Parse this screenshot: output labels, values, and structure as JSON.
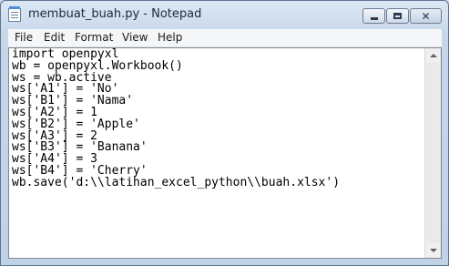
{
  "window": {
    "title": "membuat_buah.py - Notepad",
    "icon": "notepad-icon"
  },
  "controls": {
    "minimize_icon": "minimize-icon",
    "maximize_icon": "maximize-icon",
    "close_glyph": "✕"
  },
  "menu": [
    "File",
    "Edit",
    "Format",
    "View",
    "Help"
  ],
  "editor": {
    "lines": [
      "import openpyxl",
      "wb = openpyxl.Workbook()",
      "ws = wb.active",
      "ws['A1'] = 'No'",
      "ws['B1'] = 'Nama'",
      "ws['A2'] = 1",
      "ws['B2'] = 'Apple'",
      "ws['A3'] = 2",
      "ws['B3'] = 'Banana'",
      "ws['A4'] = 3",
      "ws['B4'] = 'Cherry'",
      "wb.save('d:\\\\latihan_excel_python\\\\buah.xlsx')"
    ]
  },
  "scrollbar": {
    "up_icon": "scroll-up-arrow-icon",
    "down_icon": "scroll-down-arrow-icon"
  }
}
